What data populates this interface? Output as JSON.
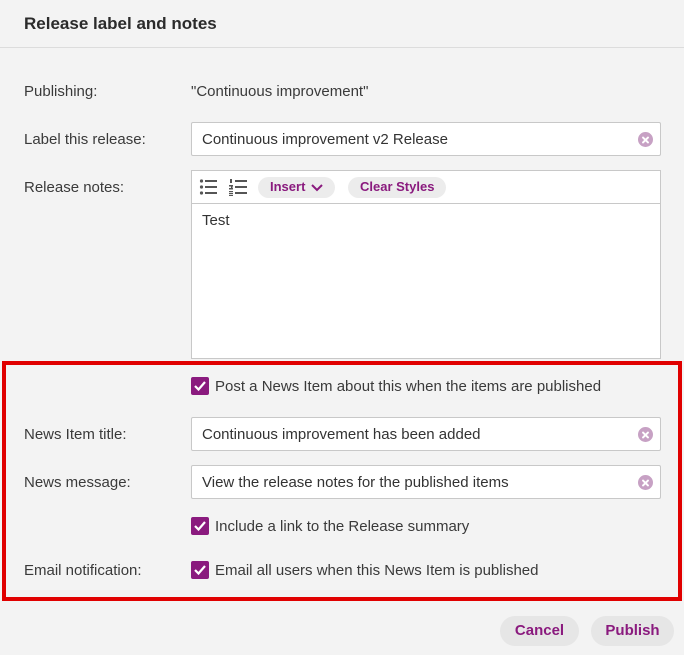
{
  "dialog": {
    "title": "Release label and notes"
  },
  "form": {
    "publishing_label": "Publishing:",
    "publishing_value": "\"Continuous improvement\"",
    "release_label_label": "Label this release:",
    "release_label_value": "Continuous improvement v2 Release",
    "release_notes_label": "Release notes:",
    "toolbar": {
      "bullet_list_icon": "bullet-list-icon",
      "numbered_list_icon": "numbered-list-icon",
      "insert_label": "Insert",
      "clear_styles_label": "Clear Styles"
    },
    "release_notes_value": "Test",
    "post_news_checkbox": {
      "label": "Post a News Item about this when the items are published",
      "checked": true
    },
    "news_title_label": "News Item title:",
    "news_title_value": "Continuous improvement has been added",
    "news_message_label": "News message:",
    "news_message_value": "View the release notes for the published items",
    "include_link_checkbox": {
      "label": "Include a link to the Release summary",
      "checked": true
    },
    "email_label": "Email notification:",
    "email_checkbox": {
      "label": "Email all users when this News Item is published",
      "checked": true
    }
  },
  "footer": {
    "cancel_label": "Cancel",
    "publish_label": "Publish"
  },
  "colors": {
    "accent": "#8a1a7e",
    "highlight": "#e00000"
  }
}
